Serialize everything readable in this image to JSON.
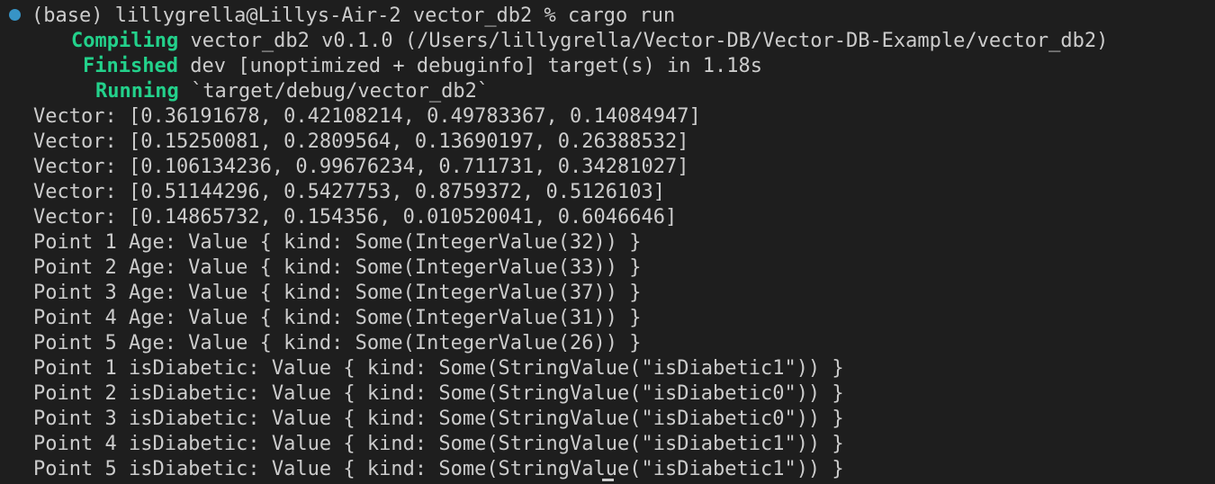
{
  "terminal": {
    "colors": {
      "background": "#1e1e1e",
      "foreground": "#cccccc",
      "status_green": "#23d18b",
      "prompt_dot": "#3794c6"
    },
    "prompt": {
      "icon": "circle-dot-icon",
      "text": "(base) lillygrella@Lillys-Air-2 vector_db2 % cargo run"
    },
    "cargo": [
      {
        "status": "Compiling",
        "message": " vector_db2 v0.1.0 (/Users/lillygrella/Vector-DB/Vector-DB-Example/vector_db2)"
      },
      {
        "status": "Finished",
        "message": " dev [unoptimized + debuginfo] target(s) in 1.18s"
      },
      {
        "status": "Running",
        "message": " `target/debug/vector_db2`"
      }
    ],
    "output": [
      "Vector: [0.36191678, 0.42108214, 0.49783367, 0.14084947]",
      "Vector: [0.15250081, 0.2809564, 0.13690197, 0.26388532]",
      "Vector: [0.106134236, 0.99676234, 0.711731, 0.34281027]",
      "Vector: [0.51144296, 0.5427753, 0.8759372, 0.5126103]",
      "Vector: [0.14865732, 0.154356, 0.010520041, 0.6046646]",
      "Point 1 Age: Value { kind: Some(IntegerValue(32)) }",
      "Point 2 Age: Value { kind: Some(IntegerValue(33)) }",
      "Point 3 Age: Value { kind: Some(IntegerValue(37)) }",
      "Point 4 Age: Value { kind: Some(IntegerValue(31)) }",
      "Point 5 Age: Value { kind: Some(IntegerValue(26)) }",
      "Point 1 isDiabetic: Value { kind: Some(StringValue(\"isDiabetic1\")) }",
      "Point 2 isDiabetic: Value { kind: Some(StringValue(\"isDiabetic0\")) }",
      "Point 3 isDiabetic: Value { kind: Some(StringValue(\"isDiabetic0\")) }",
      "Point 4 isDiabetic: Value { kind: Some(StringValue(\"isDiabetic1\")) }",
      "Point 5 isDiabetic: Value { kind: Some(StringValue(\"isDiabetic1\")) }"
    ]
  }
}
